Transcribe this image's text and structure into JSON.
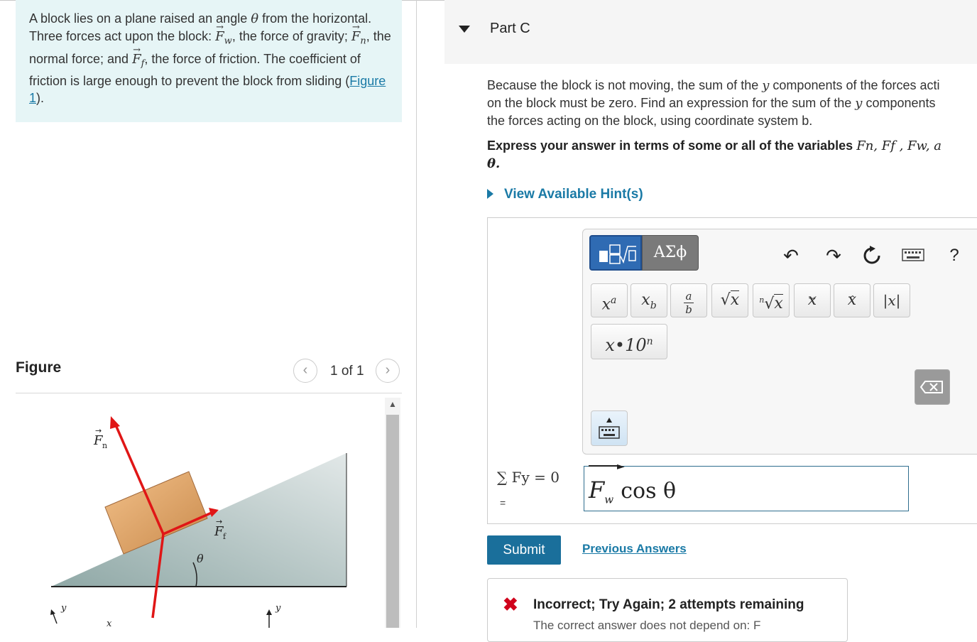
{
  "problem": {
    "intro_1": "A block lies on a plane raised an angle",
    "theta": "θ",
    "intro_2": "from the horizontal. Three forces act upon the block:",
    "fw": "F",
    "fw_sub": "w",
    "intro_3": ", the force of gravity;",
    "fn": "F",
    "fn_sub": "n",
    "intro_4": ", the normal force; and",
    "ff": "F",
    "ff_sub": "f",
    "intro_5": ", the force of friction. The coefficient of friction is large enough to prevent the block from sliding (",
    "figure_link": "Figure 1",
    "intro_6": ")."
  },
  "figure_panel": {
    "heading": "Figure",
    "pager_text": "1 of 1",
    "prev_icon": "chevron-left-icon",
    "next_icon": "chevron-right-icon",
    "label_fn": "F",
    "label_fn_sub": "n",
    "label_ff": "F",
    "label_ff_sub": "f",
    "label_theta": "θ",
    "axis_y1": "y",
    "axis_x1": "x",
    "axis_y2": "y"
  },
  "part": {
    "title": "Part C",
    "q_1": "Because the block is not moving, the sum of the",
    "q_y1": "y",
    "q_2": "components of the forces acti",
    "q_3": "on the block must be zero. Find an expression for the sum of the",
    "q_y2": "y",
    "q_4": "components",
    "q_5": "the forces acting on the block, using coordinate system b.",
    "express_1": "Express your answer in terms of some or all of the variables",
    "express_vars": "Fn, Ff , Fw, a",
    "express_theta": "θ.",
    "hint_link": "View Available Hint(s)"
  },
  "toolbar": {
    "templates_icon": "templates-icon",
    "greek_label": "ΑΣϕ",
    "undo_icon": "undo-icon",
    "redo_icon": "redo-icon",
    "reset_icon": "reset-icon",
    "keyboard_icon": "keyboard-icon",
    "help_label": "?",
    "symbols": [
      "xa",
      "xb",
      "a/b",
      "√x",
      "n√x",
      "x→",
      "x^",
      "|x|"
    ],
    "sci_label": "x•10n",
    "backspace_icon": "backspace-icon"
  },
  "answer": {
    "lhs": "∑ Fy = 0",
    "lhs_eq": "=",
    "input_value": "F w cos θ",
    "input_var": "F",
    "input_sub": "w",
    "input_rest": "cos θ"
  },
  "actions": {
    "submit": "Submit",
    "previous_answers": "Previous Answers"
  },
  "feedback": {
    "status_icon": "x-icon",
    "message": "Incorrect; Try Again; 2 attempts remaining",
    "detail": "The correct answer does not depend on: F"
  },
  "colors": {
    "intro_bg": "#e6f5f6",
    "link": "#1a7aa6",
    "submit_bg": "#1a6f9b",
    "error": "#d0021b",
    "template_btn": "#2f6bb3"
  }
}
